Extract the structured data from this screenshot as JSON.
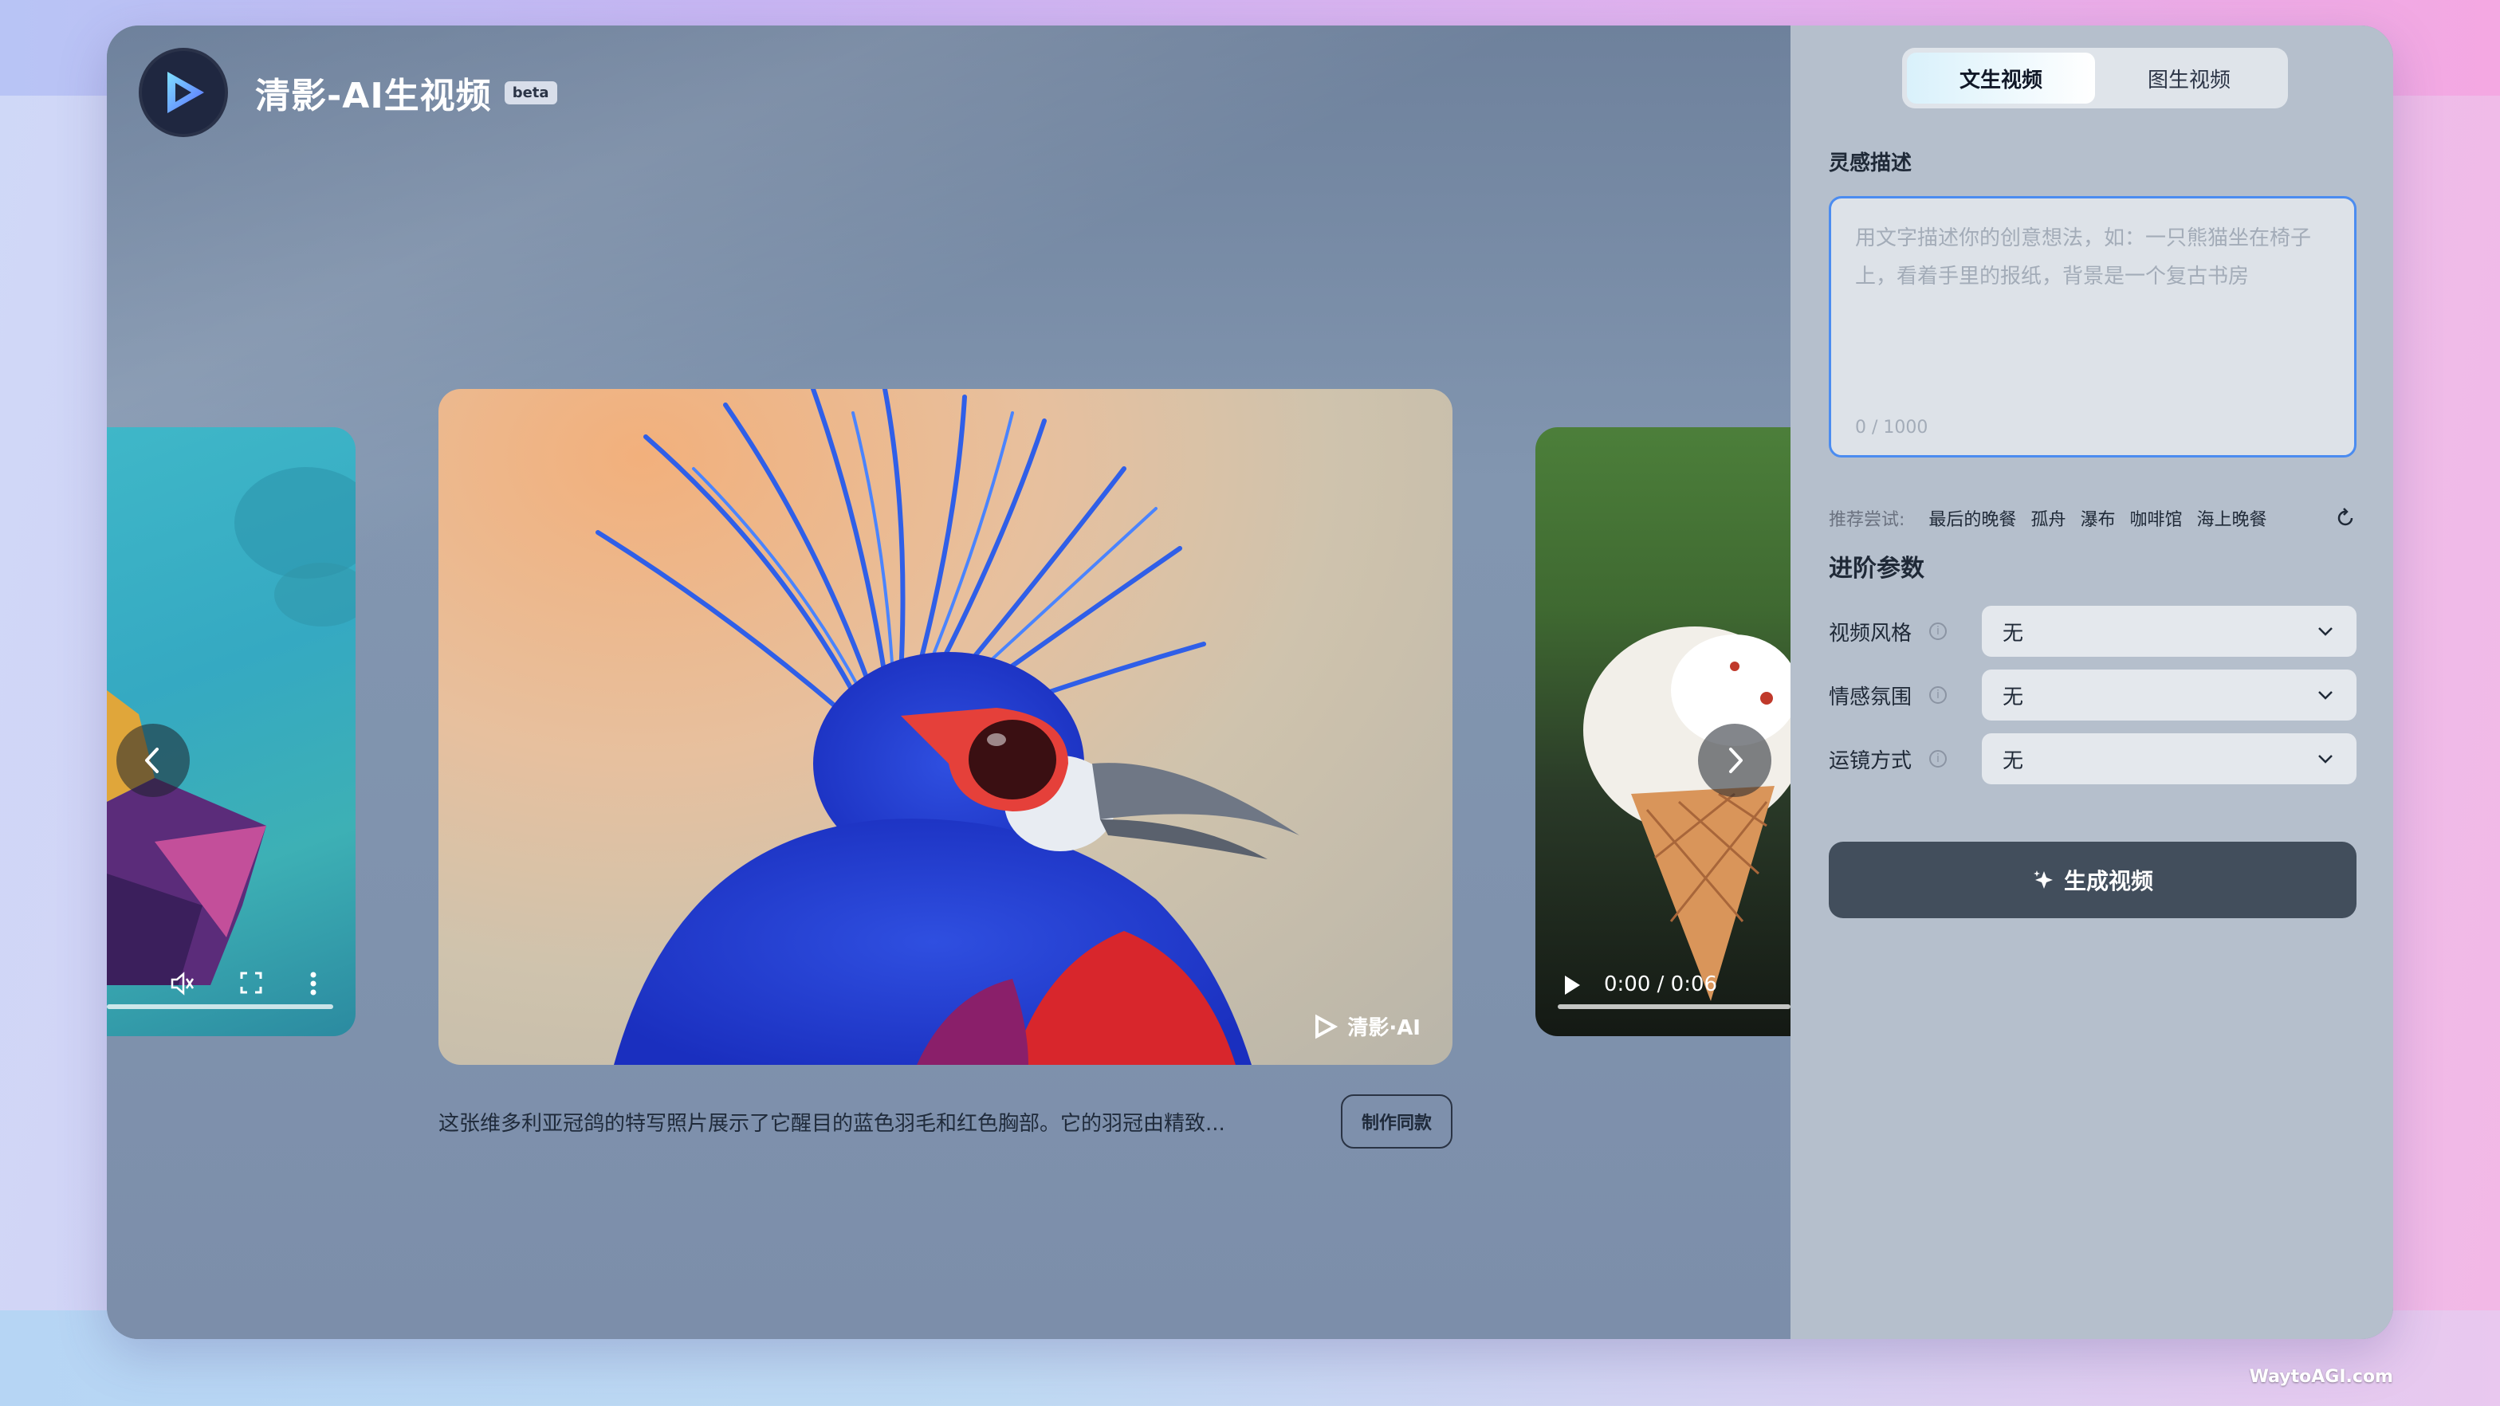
{
  "app": {
    "title": "清影-AI生视频",
    "beta": "beta"
  },
  "carousel": {
    "main_watermark": "清影·AI",
    "right_time": "0:00 / 0:06",
    "caption": "这张维多利亚冠鸽的特写照片展示了它醒目的蓝色羽毛和红色胸部。它的羽冠由精致...",
    "make_same": "制作同款"
  },
  "panel": {
    "tabs": [
      {
        "label": "文生视频",
        "active": true
      },
      {
        "label": "图生视频",
        "active": false
      }
    ],
    "inspiration_label": "灵感描述",
    "prompt": {
      "placeholder": "用文字描述你的创意想法，如：一只熊猫坐在椅子上，看着手里的报纸，背景是一个复古书房",
      "counter": "0 / 1000"
    },
    "suggest": {
      "label": "推荐尝试:",
      "chips": [
        "最后的晚餐",
        "孤舟",
        "瀑布",
        "咖啡馆",
        "海上晚餐"
      ]
    },
    "advanced_label": "进阶参数",
    "params": [
      {
        "label": "视频风格",
        "value": "无"
      },
      {
        "label": "情感氛围",
        "value": "无"
      },
      {
        "label": "运镜方式",
        "value": "无"
      }
    ],
    "generate_label": "生成视频"
  },
  "footer": {
    "watermark": "WaytoAGI.com"
  },
  "colors": {
    "accent": "#4b8cf0",
    "button": "#424e5c"
  }
}
